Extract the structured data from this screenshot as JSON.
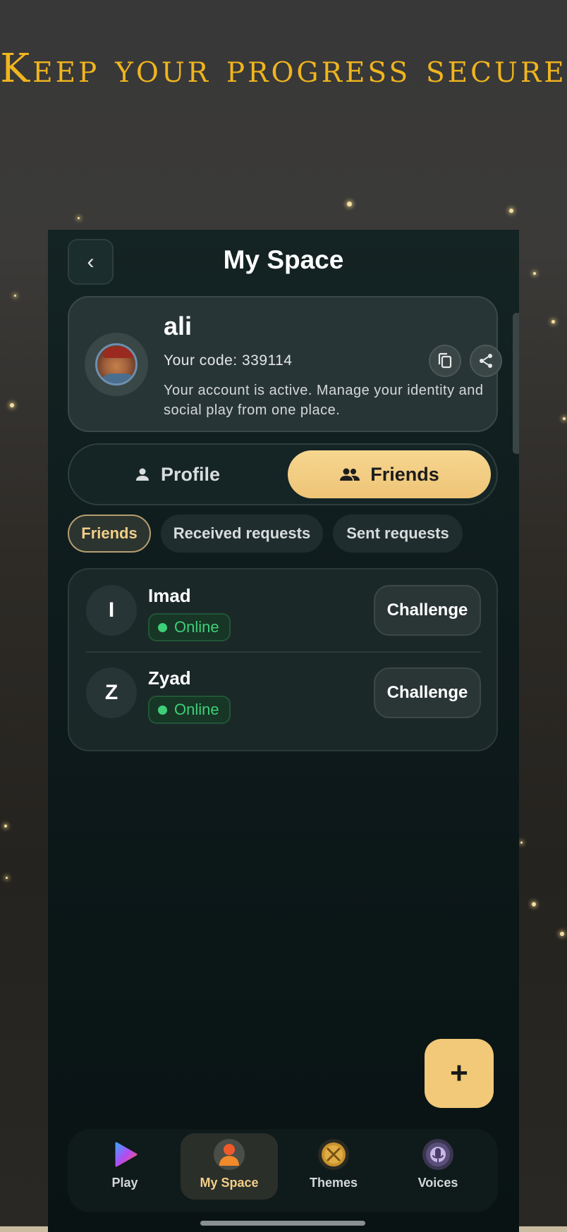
{
  "headline": "Keep your progress secure",
  "app": {
    "title": "My Space",
    "back_label": "‹"
  },
  "profile": {
    "name": "ali",
    "code_text": "Your code: 339114",
    "description": "Your account is active. Manage your identity and social play from one place."
  },
  "segments": {
    "profile_label": "Profile",
    "friends_label": "Friends",
    "selected": "Friends"
  },
  "chips": [
    {
      "label": "Friends",
      "active": true
    },
    {
      "label": "Received requests",
      "active": false
    },
    {
      "label": "Sent requests",
      "active": false
    }
  ],
  "friends": [
    {
      "initial": "I",
      "name": "Imad",
      "status": "Online",
      "action": "Challenge"
    },
    {
      "initial": "Z",
      "name": "Zyad",
      "status": "Online",
      "action": "Challenge"
    }
  ],
  "fab_label": "+",
  "nav": [
    {
      "label": "Play",
      "icon": "play-icon",
      "active": false
    },
    {
      "label": "My Space",
      "icon": "person-icon",
      "active": true
    },
    {
      "label": "Themes",
      "icon": "themes-icon",
      "active": false
    },
    {
      "label": "Voices",
      "icon": "voices-icon",
      "active": false
    }
  ],
  "colors": {
    "accent": "#f1c978",
    "headline": "#f0b51e",
    "online": "#3fcf78",
    "background": "#0f1c1d"
  }
}
